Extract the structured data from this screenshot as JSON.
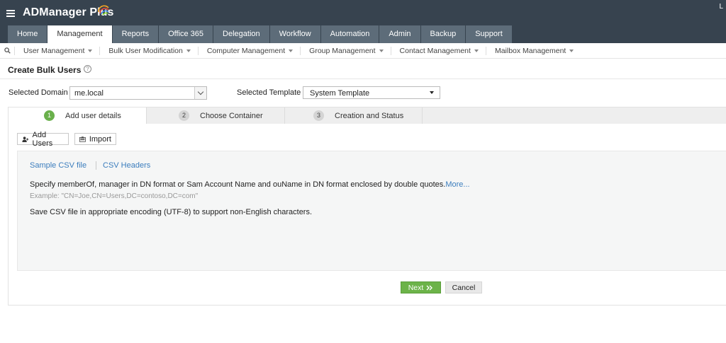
{
  "app": {
    "title": "ADManager Plus",
    "user_initial": "L"
  },
  "main_tabs": [
    {
      "label": "Home",
      "active": false
    },
    {
      "label": "Management",
      "active": true
    },
    {
      "label": "Reports",
      "active": false
    },
    {
      "label": "Office 365",
      "active": false
    },
    {
      "label": "Delegation",
      "active": false
    },
    {
      "label": "Workflow",
      "active": false
    },
    {
      "label": "Automation",
      "active": false
    },
    {
      "label": "Admin",
      "active": false
    },
    {
      "label": "Backup",
      "active": false
    },
    {
      "label": "Support",
      "active": false
    }
  ],
  "sub_nav": [
    {
      "label": "User Management"
    },
    {
      "label": "Bulk User Modification"
    },
    {
      "label": "Computer Management"
    },
    {
      "label": "Group Management"
    },
    {
      "label": "Contact Management"
    },
    {
      "label": "Mailbox Management"
    }
  ],
  "page": {
    "title": "Create Bulk Users",
    "help_icon": "?",
    "domain_label": "Selected Domain",
    "domain_value": "me.local",
    "template_label": "Selected Template",
    "template_value": "System Template"
  },
  "steps": [
    {
      "num": "1",
      "label": "Add user details",
      "active": true
    },
    {
      "num": "2",
      "label": "Choose Container",
      "active": false
    },
    {
      "num": "3",
      "label": "Creation and Status",
      "active": false
    }
  ],
  "toolbar": {
    "add_users": "Add Users",
    "import": "Import"
  },
  "panel": {
    "sample_csv": "Sample CSV file",
    "csv_headers": "CSV Headers",
    "info1": "Specify memberOf, manager in DN format or Sam Account Name and ouName in DN format enclosed by double quotes.",
    "more": "More...",
    "example": "Example: \"CN=Joe,CN=Users,DC=contoso,DC=com\"",
    "info2": "Save CSV file in appropriate encoding (UTF-8) to support non-English characters."
  },
  "actions": {
    "next": "Next",
    "cancel": "Cancel"
  },
  "colors": {
    "header_bg": "#37434f",
    "tab_bg": "#5d6c79",
    "accent_green": "#6cb349",
    "link_blue": "#3b7dbd"
  }
}
